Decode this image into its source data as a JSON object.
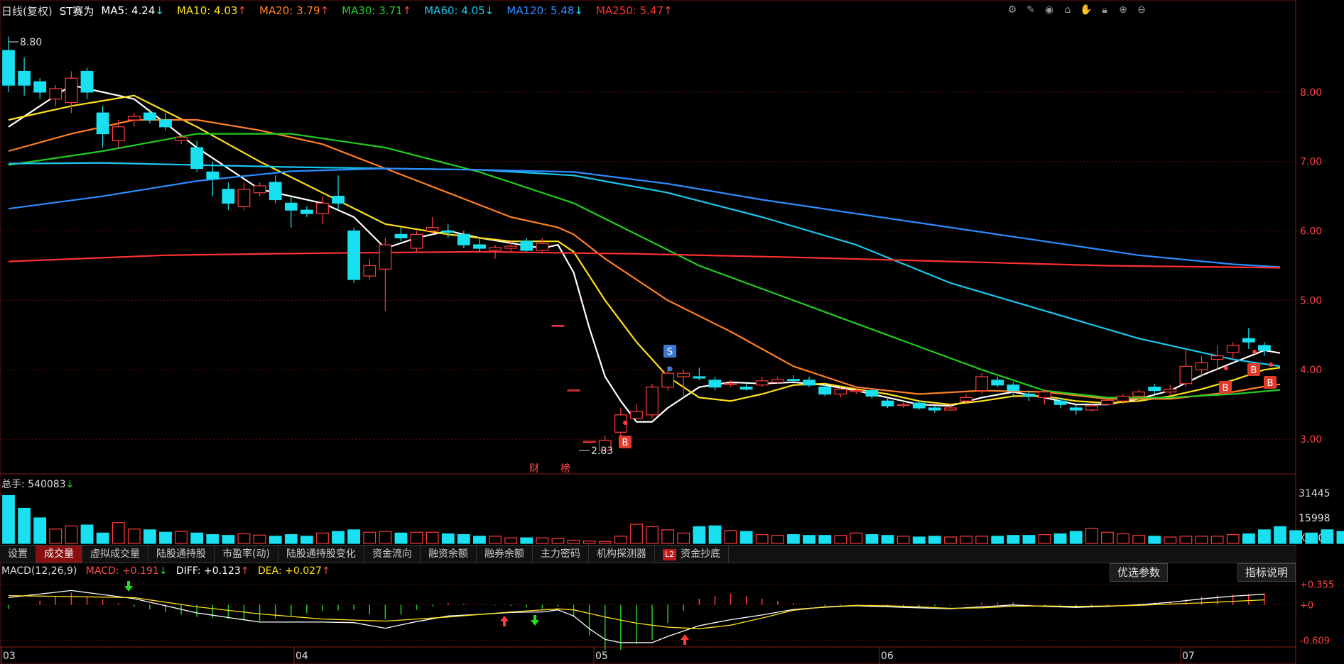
{
  "header": {
    "period": "日线(复权)",
    "stock": "ST赛为",
    "ma_items": [
      {
        "label": "MA5: 4.24",
        "arrow": "↓",
        "color": "#ffffff"
      },
      {
        "label": "MA10: 4.03",
        "arrow": "↑",
        "color": "#ffe21a"
      },
      {
        "label": "MA20: 3.79",
        "arrow": "↑",
        "color": "#ff7f26"
      },
      {
        "label": "MA30: 3.71",
        "arrow": "↑",
        "color": "#22cc22"
      },
      {
        "label": "MA60: 4.05",
        "arrow": "↓",
        "color": "#19c6ee"
      },
      {
        "label": "MA120: 5.48",
        "arrow": "↓",
        "color": "#2d8cff"
      },
      {
        "label": "MA250: 5.47",
        "arrow": "↑",
        "color": "#ff3030"
      }
    ],
    "tools": [
      "settings-icon",
      "pen-icon",
      "eye-icon",
      "bucket-icon",
      "hand-icon",
      "lock-icon",
      "zoom-in-icon",
      "zoom-out-icon"
    ]
  },
  "price_axis": [
    "8.00",
    "7.00",
    "6.00",
    "5.00",
    "4.00",
    "3.00"
  ],
  "annotations": {
    "high": "8.80",
    "low": "2.83",
    "sell_marker": "S",
    "buy_marker": "B",
    "event_labels": [
      "财",
      "榜"
    ]
  },
  "volume": {
    "label": "总手: 540083",
    "arrow": "↓",
    "axis": [
      "31445",
      "15998"
    ],
    "unit": "X100"
  },
  "tabs": [
    {
      "label": "设置",
      "active": false
    },
    {
      "label": "成交量",
      "active": true
    },
    {
      "label": "虚拟成交量",
      "active": false
    },
    {
      "label": "陆股通持股",
      "active": false
    },
    {
      "label": "市盈率(动)",
      "active": false
    },
    {
      "label": "陆股通持股变化",
      "active": false
    },
    {
      "label": "资金流向",
      "active": false
    },
    {
      "label": "融资余额",
      "active": false
    },
    {
      "label": "融券余额",
      "active": false
    },
    {
      "label": "主力密码",
      "active": false
    },
    {
      "label": "机构探测器",
      "active": false
    },
    {
      "label": "资金抄底",
      "active": false,
      "badge": "L2"
    }
  ],
  "macd": {
    "title": "MACD(12,26,9)",
    "macd": "MACD: +0.191",
    "macd_arrow": "↓",
    "diff": "DIFF: +0.123",
    "diff_arrow": "↑",
    "dea": "DEA: +0.027",
    "dea_arrow": "↑",
    "axis": [
      "+0.355",
      "+0",
      "-0.609"
    ],
    "btn_params": "优选参数",
    "btn_help": "指标说明"
  },
  "date_axis": [
    "03",
    "04",
    "05",
    "06",
    "07"
  ],
  "colors": {
    "up": "#ff3b3b",
    "down": "#19e0f0",
    "grid": "#6a1010"
  },
  "chart_data": {
    "type": "candlestick",
    "y_range": [
      2.5,
      9.0
    ],
    "candles": [
      [
        8.6,
        8.1,
        8.8,
        8.0
      ],
      [
        8.3,
        8.1,
        8.5,
        7.95
      ],
      [
        8.15,
        8.0,
        8.2,
        7.9
      ],
      [
        7.9,
        8.05,
        8.1,
        7.8
      ],
      [
        7.85,
        8.2,
        8.3,
        7.7
      ],
      [
        8.3,
        8.0,
        8.35,
        7.9
      ],
      [
        7.7,
        7.4,
        7.8,
        7.2
      ],
      [
        7.3,
        7.5,
        7.6,
        7.2
      ],
      [
        7.6,
        7.65,
        7.7,
        7.5
      ],
      [
        7.7,
        7.6,
        7.75,
        7.55
      ],
      [
        7.6,
        7.5,
        7.7,
        7.45
      ],
      [
        7.3,
        7.35,
        7.4,
        7.25
      ],
      [
        7.2,
        6.9,
        7.3,
        6.85
      ],
      [
        6.85,
        6.75,
        7.0,
        6.5
      ],
      [
        6.6,
        6.4,
        6.7,
        6.3
      ],
      [
        6.35,
        6.6,
        6.7,
        6.3
      ],
      [
        6.55,
        6.65,
        6.7,
        6.5
      ],
      [
        6.7,
        6.45,
        6.8,
        6.4
      ],
      [
        6.4,
        6.3,
        6.5,
        6.05
      ],
      [
        6.3,
        6.25,
        6.35,
        6.2
      ],
      [
        6.25,
        6.4,
        6.5,
        6.1
      ],
      [
        6.5,
        6.4,
        6.8,
        6.3
      ],
      [
        6.0,
        5.3,
        6.05,
        5.25
      ],
      [
        5.35,
        5.5,
        5.6,
        5.3
      ],
      [
        5.45,
        5.8,
        5.9,
        4.85
      ],
      [
        5.95,
        5.9,
        6.05,
        5.85
      ],
      [
        5.75,
        5.95,
        6.0,
        5.7
      ],
      [
        6.0,
        6.05,
        6.2,
        5.95
      ],
      [
        6.0,
        5.98,
        6.1,
        5.9
      ],
      [
        5.95,
        5.8,
        6.0,
        5.75
      ],
      [
        5.8,
        5.75,
        5.9,
        5.7
      ],
      [
        5.72,
        5.76,
        5.8,
        5.6
      ],
      [
        5.75,
        5.78,
        5.85,
        5.7
      ],
      [
        5.85,
        5.72,
        5.9,
        5.7
      ],
      [
        5.72,
        5.82,
        5.9,
        5.7
      ],
      [
        4.64,
        4.64,
        4.64,
        4.64
      ],
      [
        3.71,
        3.71,
        3.71,
        3.71
      ],
      [
        2.97,
        2.97,
        2.97,
        2.97
      ],
      [
        2.84,
        2.98,
        3.05,
        2.83
      ],
      [
        3.1,
        3.35,
        3.45,
        3.05
      ],
      [
        3.3,
        3.4,
        3.5,
        3.3
      ],
      [
        3.35,
        3.75,
        3.8,
        3.3
      ],
      [
        3.75,
        3.95,
        4.05,
        3.7
      ],
      [
        3.9,
        3.95,
        4.0,
        3.6
      ],
      [
        3.9,
        3.88,
        4.03,
        3.85
      ],
      [
        3.85,
        3.75,
        3.9,
        3.7
      ],
      [
        3.8,
        3.8,
        3.85,
        3.75
      ],
      [
        3.75,
        3.72,
        3.8,
        3.7
      ],
      [
        3.78,
        3.84,
        3.9,
        3.75
      ],
      [
        3.82,
        3.86,
        3.9,
        3.8
      ],
      [
        3.86,
        3.85,
        3.92,
        3.8
      ],
      [
        3.85,
        3.78,
        3.9,
        3.75
      ],
      [
        3.75,
        3.65,
        3.8,
        3.62
      ],
      [
        3.65,
        3.72,
        3.75,
        3.6
      ],
      [
        3.7,
        3.7,
        3.75,
        3.65
      ],
      [
        3.7,
        3.62,
        3.72,
        3.58
      ],
      [
        3.55,
        3.48,
        3.6,
        3.45
      ],
      [
        3.5,
        3.5,
        3.55,
        3.45
      ],
      [
        3.52,
        3.45,
        3.55,
        3.42
      ],
      [
        3.45,
        3.42,
        3.48,
        3.38
      ],
      [
        3.42,
        3.45,
        3.5,
        3.4
      ],
      [
        3.55,
        3.6,
        3.65,
        3.5
      ],
      [
        3.7,
        3.9,
        3.95,
        3.65
      ],
      [
        3.85,
        3.78,
        3.9,
        3.75
      ],
      [
        3.78,
        3.7,
        3.82,
        3.6
      ],
      [
        3.65,
        3.62,
        3.7,
        3.55
      ],
      [
        3.6,
        3.68,
        3.72,
        3.5
      ],
      [
        3.55,
        3.5,
        3.6,
        3.45
      ],
      [
        3.45,
        3.42,
        3.5,
        3.35
      ],
      [
        3.42,
        3.48,
        3.52,
        3.4
      ],
      [
        3.5,
        3.56,
        3.6,
        3.48
      ],
      [
        3.55,
        3.62,
        3.65,
        3.5
      ],
      [
        3.62,
        3.68,
        3.72,
        3.6
      ],
      [
        3.75,
        3.7,
        3.8,
        3.65
      ],
      [
        3.68,
        3.72,
        3.78,
        3.62
      ],
      [
        3.8,
        4.05,
        4.3,
        3.75
      ],
      [
        4.0,
        4.1,
        4.2,
        3.9
      ],
      [
        4.15,
        4.2,
        4.35,
        4.0
      ],
      [
        4.25,
        4.35,
        4.4,
        4.15
      ],
      [
        4.45,
        4.4,
        4.6,
        4.3
      ],
      [
        4.35,
        4.28,
        4.4,
        4.2
      ]
    ],
    "ma": [
      {
        "name": "MA5",
        "color": "#ffffff",
        "points": [
          [
            0,
            7.5
          ],
          [
            4,
            8.1
          ],
          [
            8,
            7.9
          ],
          [
            12,
            7.2
          ],
          [
            16,
            6.6
          ],
          [
            20,
            6.4
          ],
          [
            22,
            6.2
          ],
          [
            24,
            5.75
          ],
          [
            26,
            5.9
          ],
          [
            28,
            6.0
          ],
          [
            30,
            5.9
          ],
          [
            34,
            5.75
          ],
          [
            35,
            5.8
          ],
          [
            36,
            5.4
          ],
          [
            37,
            4.6
          ],
          [
            38,
            3.9
          ],
          [
            39,
            3.55
          ],
          [
            40,
            3.25
          ],
          [
            41,
            3.25
          ],
          [
            42,
            3.45
          ],
          [
            44,
            3.75
          ],
          [
            46,
            3.82
          ],
          [
            48,
            3.8
          ],
          [
            50,
            3.82
          ],
          [
            52,
            3.78
          ],
          [
            54,
            3.7
          ],
          [
            56,
            3.6
          ],
          [
            58,
            3.5
          ],
          [
            60,
            3.48
          ],
          [
            62,
            3.6
          ],
          [
            64,
            3.68
          ],
          [
            66,
            3.6
          ],
          [
            68,
            3.5
          ],
          [
            70,
            3.5
          ],
          [
            72,
            3.58
          ],
          [
            74,
            3.7
          ],
          [
            76,
            3.92
          ],
          [
            78,
            4.1
          ],
          [
            80,
            4.28
          ],
          [
            81,
            4.24
          ]
        ]
      },
      {
        "name": "MA10",
        "color": "#ffe21a",
        "points": [
          [
            0,
            7.6
          ],
          [
            4,
            7.8
          ],
          [
            8,
            7.95
          ],
          [
            12,
            7.5
          ],
          [
            16,
            7.0
          ],
          [
            20,
            6.55
          ],
          [
            24,
            6.1
          ],
          [
            28,
            5.95
          ],
          [
            32,
            5.85
          ],
          [
            35,
            5.85
          ],
          [
            36,
            5.7
          ],
          [
            38,
            5.0
          ],
          [
            40,
            4.4
          ],
          [
            42,
            3.9
          ],
          [
            44,
            3.6
          ],
          [
            46,
            3.55
          ],
          [
            48,
            3.65
          ],
          [
            50,
            3.78
          ],
          [
            52,
            3.8
          ],
          [
            54,
            3.72
          ],
          [
            56,
            3.65
          ],
          [
            58,
            3.55
          ],
          [
            60,
            3.5
          ],
          [
            62,
            3.55
          ],
          [
            64,
            3.62
          ],
          [
            66,
            3.62
          ],
          [
            68,
            3.55
          ],
          [
            70,
            3.52
          ],
          [
            72,
            3.55
          ],
          [
            74,
            3.62
          ],
          [
            76,
            3.72
          ],
          [
            78,
            3.85
          ],
          [
            80,
            4.0
          ],
          [
            81,
            4.03
          ]
        ]
      },
      {
        "name": "MA20",
        "color": "#ff7f26",
        "points": [
          [
            0,
            7.15
          ],
          [
            4,
            7.4
          ],
          [
            8,
            7.6
          ],
          [
            12,
            7.6
          ],
          [
            16,
            7.45
          ],
          [
            20,
            7.25
          ],
          [
            24,
            6.9
          ],
          [
            28,
            6.55
          ],
          [
            32,
            6.2
          ],
          [
            35,
            6.05
          ],
          [
            36,
            5.95
          ],
          [
            38,
            5.6
          ],
          [
            42,
            5.0
          ],
          [
            46,
            4.55
          ],
          [
            50,
            4.05
          ],
          [
            54,
            3.75
          ],
          [
            58,
            3.65
          ],
          [
            62,
            3.7
          ],
          [
            66,
            3.68
          ],
          [
            70,
            3.58
          ],
          [
            74,
            3.58
          ],
          [
            78,
            3.68
          ],
          [
            80,
            3.76
          ],
          [
            81,
            3.79
          ]
        ]
      },
      {
        "name": "MA30",
        "color": "#22cc22",
        "points": [
          [
            0,
            6.95
          ],
          [
            6,
            7.15
          ],
          [
            12,
            7.4
          ],
          [
            18,
            7.4
          ],
          [
            24,
            7.2
          ],
          [
            30,
            6.85
          ],
          [
            36,
            6.4
          ],
          [
            40,
            5.95
          ],
          [
            44,
            5.5
          ],
          [
            50,
            5.0
          ],
          [
            56,
            4.5
          ],
          [
            62,
            4.0
          ],
          [
            66,
            3.7
          ],
          [
            70,
            3.6
          ],
          [
            74,
            3.6
          ],
          [
            78,
            3.65
          ],
          [
            81,
            3.71
          ]
        ]
      },
      {
        "name": "MA60",
        "color": "#19c6ee",
        "points": [
          [
            0,
            6.97
          ],
          [
            6,
            6.98
          ],
          [
            12,
            6.95
          ],
          [
            18,
            6.92
          ],
          [
            24,
            6.9
          ],
          [
            30,
            6.88
          ],
          [
            36,
            6.8
          ],
          [
            42,
            6.55
          ],
          [
            48,
            6.2
          ],
          [
            54,
            5.8
          ],
          [
            60,
            5.25
          ],
          [
            66,
            4.85
          ],
          [
            72,
            4.45
          ],
          [
            78,
            4.15
          ],
          [
            81,
            4.05
          ]
        ]
      },
      {
        "name": "MA120",
        "color": "#2d8cff",
        "points": [
          [
            0,
            6.32
          ],
          [
            6,
            6.5
          ],
          [
            12,
            6.72
          ],
          [
            18,
            6.86
          ],
          [
            24,
            6.9
          ],
          [
            30,
            6.88
          ],
          [
            36,
            6.85
          ],
          [
            42,
            6.68
          ],
          [
            48,
            6.45
          ],
          [
            54,
            6.25
          ],
          [
            60,
            6.05
          ],
          [
            66,
            5.85
          ],
          [
            72,
            5.65
          ],
          [
            78,
            5.52
          ],
          [
            81,
            5.48
          ]
        ]
      },
      {
        "name": "MA250",
        "color": "#ff3030",
        "points": [
          [
            0,
            5.56
          ],
          [
            10,
            5.65
          ],
          [
            20,
            5.68
          ],
          [
            30,
            5.7
          ],
          [
            40,
            5.67
          ],
          [
            50,
            5.62
          ],
          [
            60,
            5.56
          ],
          [
            70,
            5.5
          ],
          [
            81,
            5.47
          ]
        ]
      }
    ],
    "volume_values": [
      30000,
      22000,
      16000,
      9000,
      11000,
      11500,
      6500,
      13000,
      9000,
      8500,
      7000,
      7500,
      6500,
      5500,
      5000,
      6000,
      5200,
      4500,
      5500,
      4500,
      6500,
      7500,
      8500,
      7000,
      7500,
      6500,
      7000,
      7000,
      6000,
      5500,
      4500,
      4500,
      3500,
      3500,
      3500,
      3000,
      2000,
      1500,
      1200,
      4500,
      12000,
      10500,
      8500,
      6500,
      10500,
      11000,
      8000,
      7500,
      5500,
      5000,
      5500,
      5000,
      5000,
      5000,
      6500,
      5500,
      5000,
      4500,
      4000,
      4500,
      4000,
      4500,
      4500,
      4500,
      5000,
      5000,
      5500,
      6000,
      7500,
      9500,
      7000,
      6000,
      5000,
      4500,
      4000,
      4500,
      4500,
      4500,
      5500,
      6000,
      8500,
      10500,
      8000,
      6500,
      8500,
      7500
    ]
  }
}
